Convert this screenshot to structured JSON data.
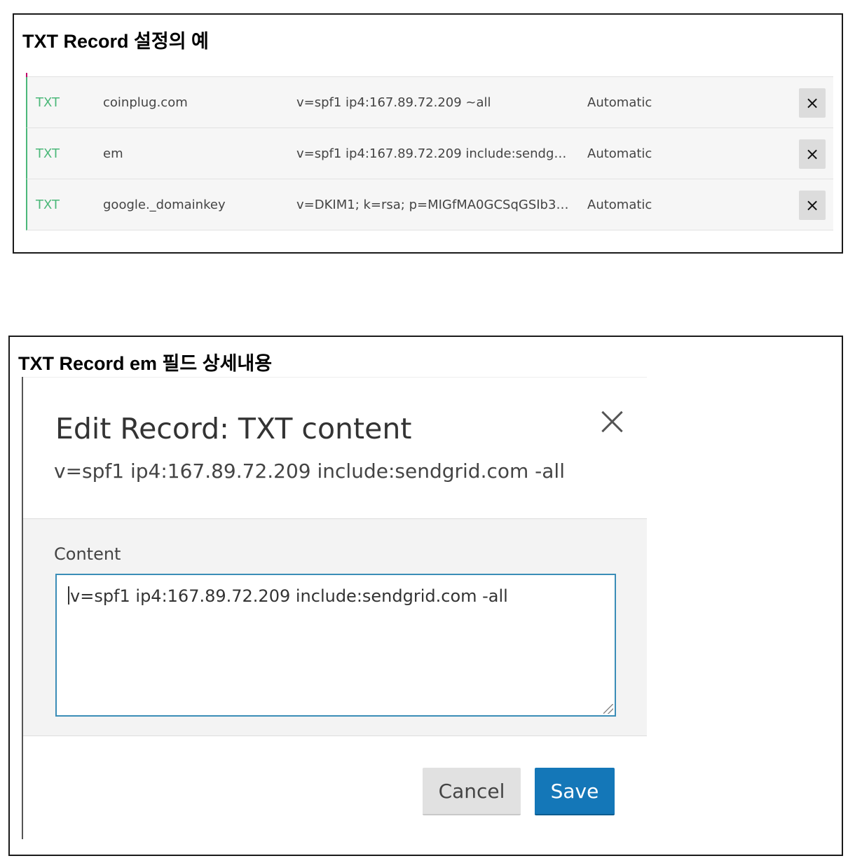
{
  "panel1": {
    "title": "TXT Record 설정의 예",
    "records": [
      {
        "type": "TXT",
        "name": "coinplug.com",
        "value": "v=spf1 ip4:167.89.72.209 ~all",
        "ttl": "Automatic",
        "delete_icon": "×"
      },
      {
        "type": "TXT",
        "name": "em",
        "value": "v=spf1 ip4:167.89.72.209 include:sendgrid.c...",
        "ttl": "Automatic",
        "delete_icon": "×"
      },
      {
        "type": "TXT",
        "name": "google._domainkey",
        "value": "v=DKIM1; k=rsa; p=MIGfMA0GCSqGSIb3DQE...",
        "ttl": "Automatic",
        "delete_icon": "×"
      }
    ]
  },
  "panel2": {
    "title": "TXT Record em 필드 상세내용",
    "dialog": {
      "title": "Edit Record: TXT content",
      "subtitle": "v=spf1 ip4:167.89.72.209 include:sendgrid.com -all",
      "content_label": "Content",
      "content_value": "v=spf1 ip4:167.89.72.209 include:sendgrid.com -all",
      "cancel_label": "Cancel",
      "save_label": "Save"
    }
  },
  "colors": {
    "accent_green": "#4cb87a",
    "save_blue": "#1477b8",
    "input_border": "#3a8db7"
  }
}
